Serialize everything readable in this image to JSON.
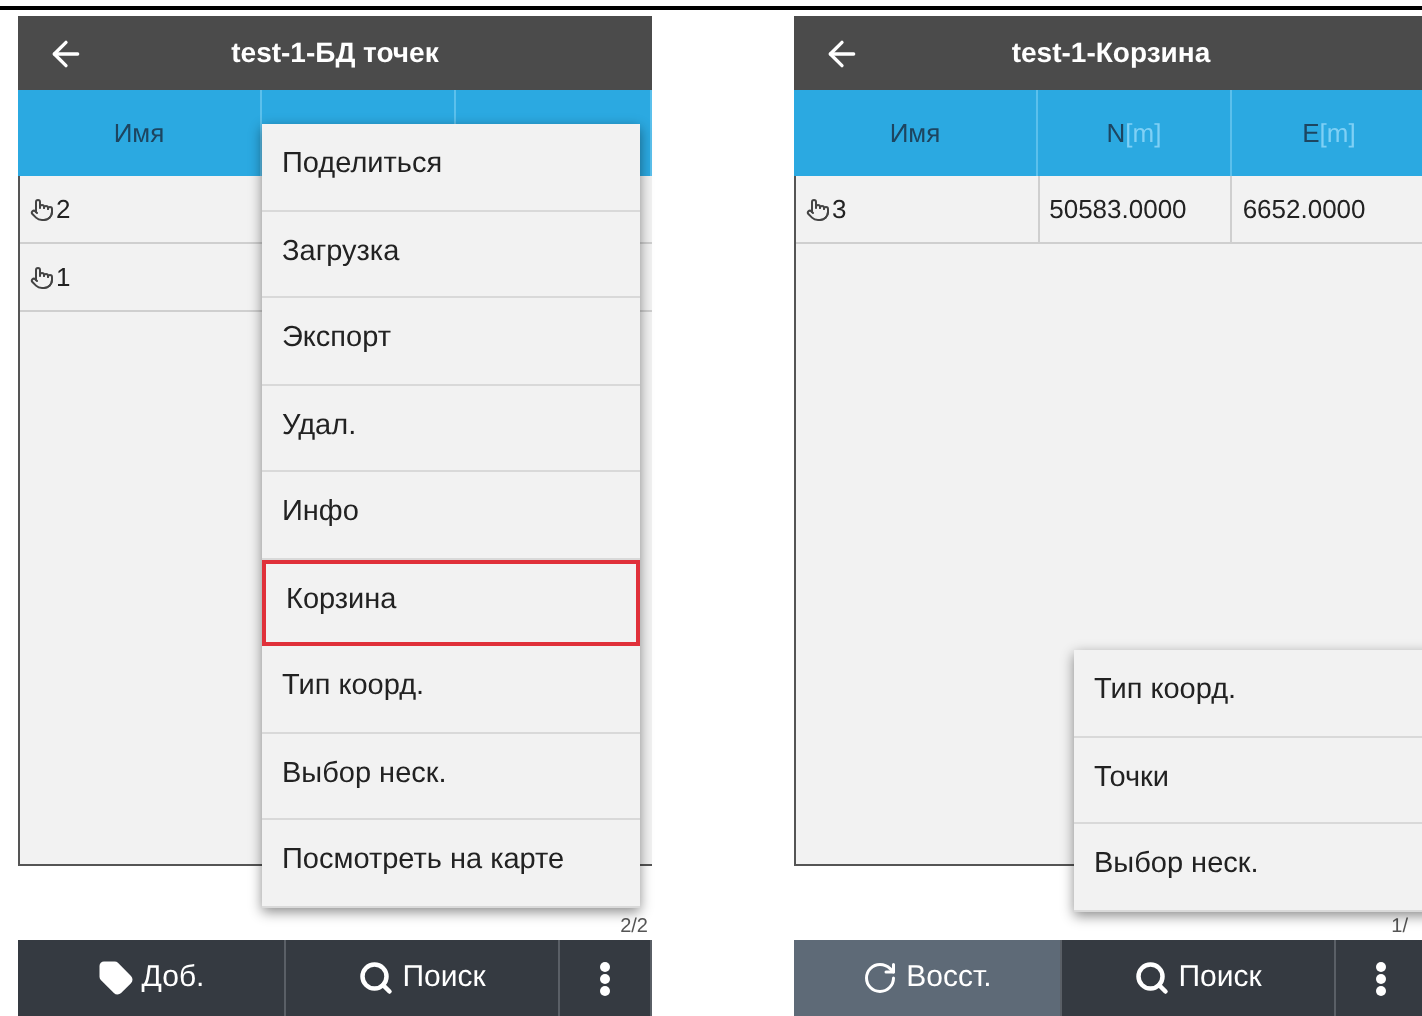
{
  "screens": [
    {
      "title": "test-1-БД точек",
      "columns": [
        {
          "name": "Имя"
        },
        {},
        {}
      ],
      "rows": [
        {
          "cells": [
            "2"
          ]
        },
        {
          "cells": [
            "1"
          ]
        }
      ],
      "page_counter": "2/2",
      "menu": {
        "items": [
          {
            "label": "Поделиться",
            "highlighted": false
          },
          {
            "label": "Загрузка",
            "highlighted": false
          },
          {
            "label": "Экспорт",
            "highlighted": false
          },
          {
            "label": "Удал.",
            "highlighted": false
          },
          {
            "label": "Инфо",
            "highlighted": false
          },
          {
            "label": "Корзина",
            "highlighted": true
          },
          {
            "label": "Тип коорд.",
            "highlighted": false
          },
          {
            "label": "Выбор неск.",
            "highlighted": false
          },
          {
            "label": "Посмотреть на карте",
            "highlighted": false
          }
        ]
      },
      "bottom_bar": [
        {
          "kind": "add",
          "label": "Доб."
        },
        {
          "kind": "search",
          "label": "Поиск"
        },
        {
          "kind": "more"
        }
      ]
    },
    {
      "title": "test-1-Корзина",
      "columns": [
        {
          "name": "Имя"
        },
        {
          "name": "N",
          "unit": "[m]"
        },
        {
          "name": "E",
          "unit": "[m]"
        }
      ],
      "rows": [
        {
          "cells": [
            "3",
            "50583.0000",
            "6652.0000"
          ]
        }
      ],
      "page_counter": "1/",
      "menu": {
        "items": [
          {
            "label": "Тип коорд.",
            "highlighted": false
          },
          {
            "label": "Точки",
            "highlighted": false
          },
          {
            "label": "Выбор неск.",
            "highlighted": false
          }
        ]
      },
      "bottom_bar": [
        {
          "kind": "restore",
          "label": "Восст."
        },
        {
          "kind": "search",
          "label": "Поиск"
        },
        {
          "kind": "more"
        }
      ]
    }
  ]
}
